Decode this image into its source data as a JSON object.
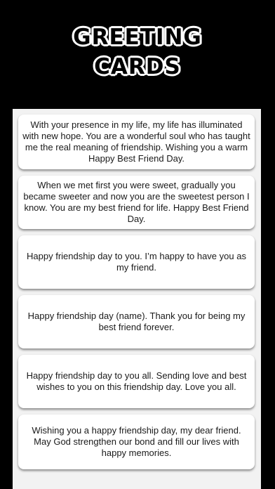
{
  "header": {
    "title_line1": "GREETING",
    "title_line2": "CARDS"
  },
  "cards": [
    "With your presence in my life, my life has illuminated with new hope. You are a wonderful soul who has taught me the real meaning of friendship. Wishing you a warm Happy Best Friend Day.",
    "When we met first you were sweet, gradually you became sweeter and now you are the sweetest person I know. You are my best friend for life. Happy Best Friend Day.",
    "Happy friendship day to you. I’m happy to have you as my friend.",
    "Happy friendship day (name). Thank you for being my best friend forever.",
    "Happy friendship day to you all. Sending love and best wishes to you on this friendship day. Love you all.",
    "Wishing you a happy friendship day, my dear friend. May God strengthen our bond and fill our lives with happy memories."
  ],
  "colors": {
    "background": "#000000",
    "panel": "#f2f2f2",
    "card": "#ffffff",
    "text": "#1a1a1a"
  }
}
